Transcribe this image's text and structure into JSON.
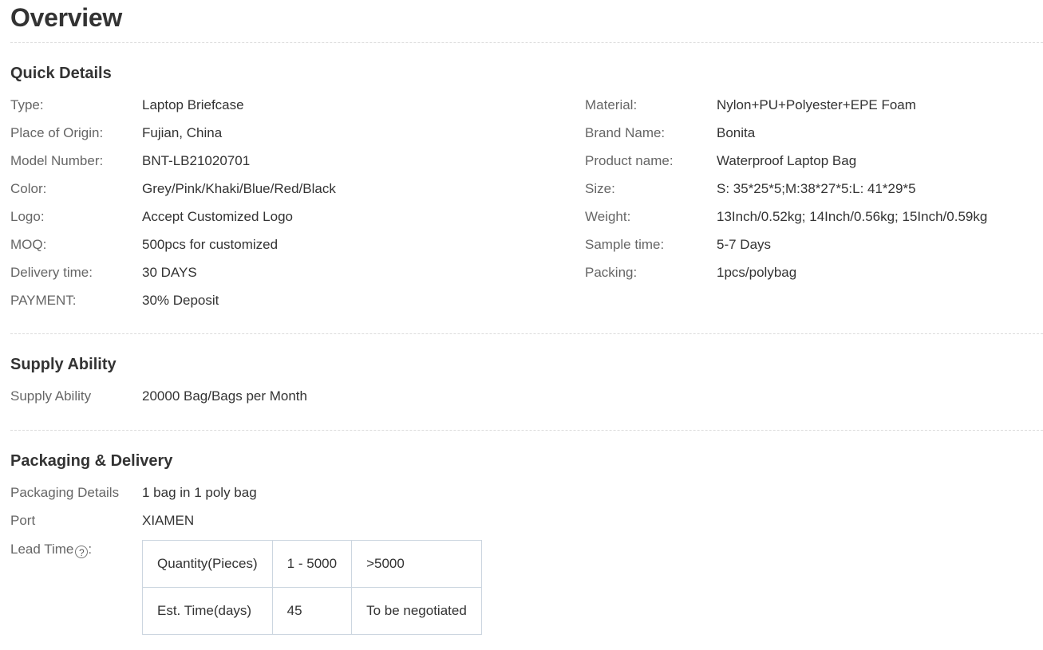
{
  "title": "Overview",
  "quick_details": {
    "heading": "Quick Details",
    "left": [
      {
        "label": "Type:",
        "value": "Laptop Briefcase"
      },
      {
        "label": "Place of Origin:",
        "value": "Fujian, China"
      },
      {
        "label": "Model Number:",
        "value": "BNT-LB21020701"
      },
      {
        "label": "Color:",
        "value": "Grey/Pink/Khaki/Blue/Red/Black"
      },
      {
        "label": "Logo:",
        "value": "Accept Customized Logo"
      },
      {
        "label": "MOQ:",
        "value": "500pcs for customized"
      },
      {
        "label": "Delivery time:",
        "value": "30 DAYS"
      },
      {
        "label": "PAYMENT:",
        "value": "30% Deposit"
      }
    ],
    "right": [
      {
        "label": "Material:",
        "value": "Nylon+PU+Polyester+EPE Foam"
      },
      {
        "label": "Brand Name:",
        "value": "Bonita"
      },
      {
        "label": "Product name:",
        "value": "Waterproof Laptop Bag"
      },
      {
        "label": "Size:",
        "value": "S: 35*25*5;M:38*27*5:L: 41*29*5"
      },
      {
        "label": "Weight:",
        "value": "13Inch/0.52kg; 14Inch/0.56kg; 15Inch/0.59kg"
      },
      {
        "label": "Sample time:",
        "value": "5-7 Days"
      },
      {
        "label": "Packing:",
        "value": "1pcs/polybag"
      }
    ]
  },
  "supply": {
    "heading": "Supply Ability",
    "label": "Supply Ability",
    "value": "20000 Bag/Bags per Month"
  },
  "packaging": {
    "heading": "Packaging & Delivery",
    "details_label": "Packaging Details",
    "details_value": "1 bag in 1 poly bag",
    "port_label": "Port",
    "port_value": "XIAMEN",
    "lead_label": "Lead Time",
    "lead_suffix": ":",
    "help_icon": "?",
    "lead_table": [
      [
        "Quantity(Pieces)",
        "1 - 5000",
        ">5000"
      ],
      [
        "Est. Time(days)",
        "45",
        "To be negotiated"
      ]
    ]
  }
}
